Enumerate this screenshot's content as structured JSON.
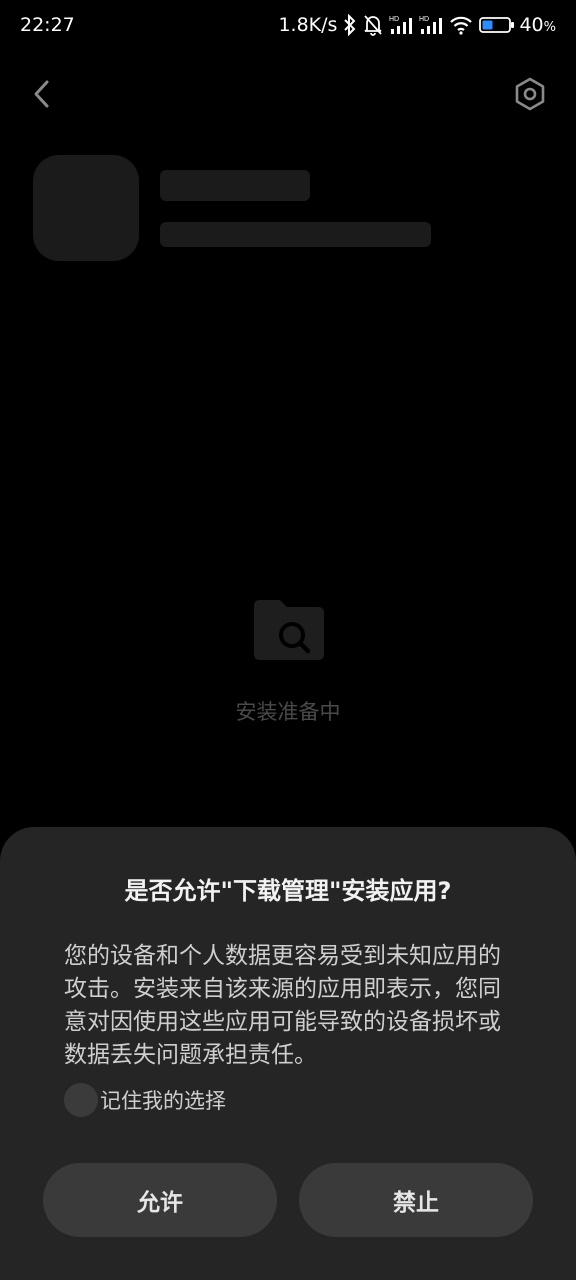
{
  "status_bar": {
    "time": "22:27",
    "net_speed": "1.8K/s",
    "sim_label_1": "HD",
    "sim_label_2": "HD",
    "battery_percent": "40",
    "battery_unit": "%",
    "icons": [
      "bluetooth-icon",
      "mute-bell-icon",
      "signal-icon",
      "signal-icon",
      "wifi-icon",
      "battery-icon"
    ]
  },
  "topbar": {
    "back_icon": "chevron-left-icon",
    "settings_icon": "hexagon-settings-icon"
  },
  "main": {
    "preparing_icon": "folder-search-icon",
    "preparing_text": "安装准备中"
  },
  "dialog": {
    "title": "是否允许\"下载管理\"安装应用?",
    "body": "您的设备和个人数据更容易受到未知应用的攻击。安装来自该来源的应用即表示，您同意对因使用这些应用可能导致的设备损坏或数据丢失问题承担责任。",
    "remember_label": "记住我的选择",
    "remember_checked": false,
    "allow_label": "允许",
    "deny_label": "禁止"
  },
  "colors": {
    "background": "#000000",
    "sheet": "#252525",
    "button": "#3a3a3a",
    "skeleton": "#1b1b1b"
  }
}
